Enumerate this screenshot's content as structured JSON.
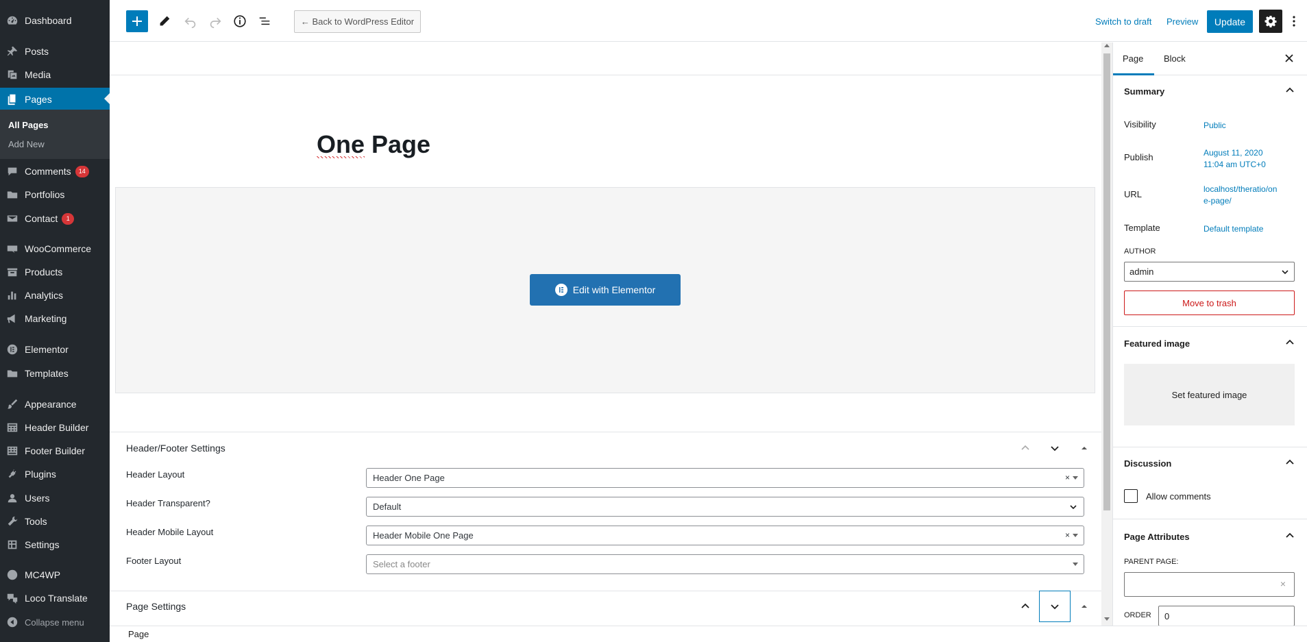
{
  "admin_menu": {
    "items": [
      {
        "label": "Dashboard",
        "icon": "dashboard-icon"
      },
      {
        "label": "Posts",
        "icon": "pin-icon"
      },
      {
        "label": "Media",
        "icon": "media-icon"
      },
      {
        "label": "Pages",
        "icon": "pages-icon"
      },
      {
        "label": "Comments",
        "icon": "comment-icon",
        "badge": "14"
      },
      {
        "label": "Portfolios",
        "icon": "folder-icon"
      },
      {
        "label": "Contact",
        "icon": "mail-icon",
        "badge": "1"
      },
      {
        "label": "WooCommerce",
        "icon": "woocommerce-icon"
      },
      {
        "label": "Products",
        "icon": "archive-icon"
      },
      {
        "label": "Analytics",
        "icon": "bar-chart-icon"
      },
      {
        "label": "Marketing",
        "icon": "megaphone-icon"
      },
      {
        "label": "Elementor",
        "icon": "elementor-icon"
      },
      {
        "label": "Templates",
        "icon": "folder-icon"
      },
      {
        "label": "Appearance",
        "icon": "paintbrush-icon"
      },
      {
        "label": "Header Builder",
        "icon": "grid-icon"
      },
      {
        "label": "Footer Builder",
        "icon": "grid-icon"
      },
      {
        "label": "Plugins",
        "icon": "plug-icon"
      },
      {
        "label": "Users",
        "icon": "user-icon"
      },
      {
        "label": "Tools",
        "icon": "wrench-icon"
      },
      {
        "label": "Settings",
        "icon": "settings-grid-icon"
      },
      {
        "label": "MC4WP",
        "icon": "mc4wp-icon"
      },
      {
        "label": "Loco Translate",
        "icon": "translate-icon"
      }
    ],
    "submenu": {
      "all_pages": "All Pages",
      "add_new": "Add New"
    },
    "collapse_label": "Collapse menu",
    "active_item": "Pages"
  },
  "toolbar": {
    "back_label": "← Back to WordPress Editor",
    "switch_to_draft": "Switch to draft",
    "preview": "Preview",
    "update": "Update"
  },
  "editor": {
    "title": "One Page",
    "elementor_button": "Edit with Elementor"
  },
  "header_footer_settings": {
    "title": "Header/Footer Settings",
    "fields": [
      {
        "label": "Header Layout",
        "value": "Header One Page",
        "clearable": true
      },
      {
        "label": "Header Transparent?",
        "value": "Default",
        "clearable": false
      },
      {
        "label": "Header Mobile Layout",
        "value": "Header Mobile One Page",
        "clearable": true
      },
      {
        "label": "Footer Layout",
        "placeholder": "Select a footer",
        "clearable": false
      }
    ]
  },
  "page_settings": {
    "title": "Page Settings"
  },
  "breadcrumb": "Page",
  "sidebar": {
    "tabs": [
      "Page",
      "Block"
    ],
    "summary": {
      "title": "Summary",
      "visibility_label": "Visibility",
      "visibility_value": "Public",
      "publish_label": "Publish",
      "publish_value_line1": "August 11, 2020",
      "publish_value_line2": "11:04 am UTC+0",
      "url_label": "URL",
      "url_value_line1": "localhost/theratio/on",
      "url_value_line2": "e-page/",
      "template_label": "Template",
      "template_value": "Default template",
      "author_label": "AUTHOR",
      "author_value": "admin",
      "trash_label": "Move to trash"
    },
    "featured_image": {
      "title": "Featured image",
      "button": "Set featured image"
    },
    "discussion": {
      "title": "Discussion",
      "allow_comments": "Allow comments",
      "checked": false
    },
    "page_attributes": {
      "title": "Page Attributes",
      "parent_label": "PARENT PAGE:",
      "order_label": "ORDER",
      "order_value": "0"
    }
  },
  "colors": {
    "admin_bg": "#23282d",
    "accent": "#007cba",
    "active_menu": "#0073aa",
    "danger": "#cc1818",
    "badge": "#d63638"
  }
}
